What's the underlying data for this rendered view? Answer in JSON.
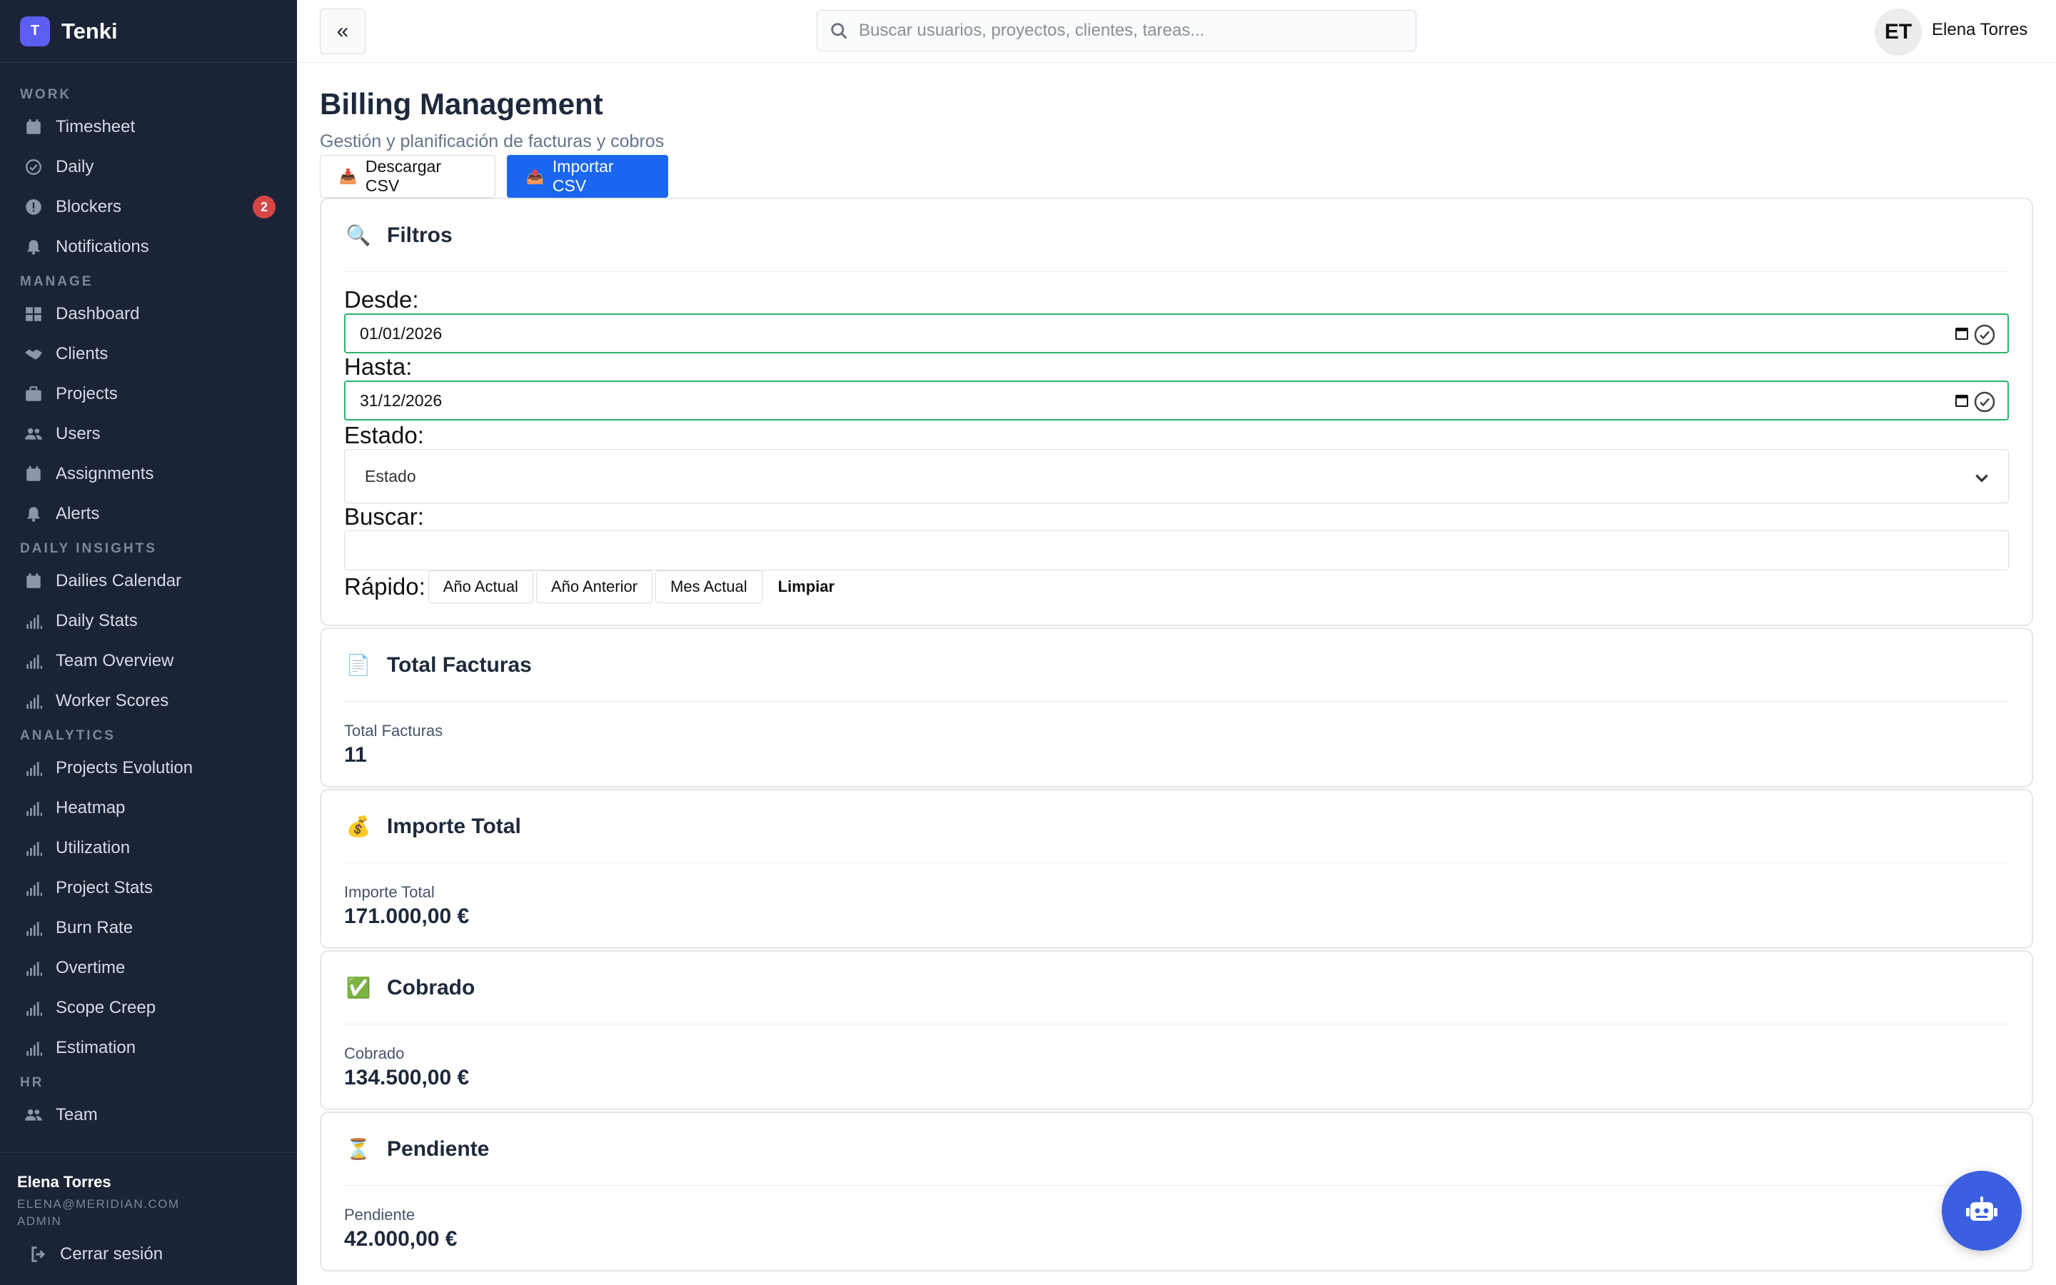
{
  "brand": {
    "logo_letter": "T",
    "name": "Tenki"
  },
  "sidebar": {
    "sections": [
      {
        "title": "WORK",
        "items": [
          {
            "label": "Timesheet",
            "icon": "calendar-icon"
          },
          {
            "label": "Daily",
            "icon": "check-circle-icon"
          },
          {
            "label": "Blockers",
            "icon": "alert-circle-icon",
            "badge": "2"
          },
          {
            "label": "Notifications",
            "icon": "bell-icon"
          }
        ]
      },
      {
        "title": "MANAGE",
        "items": [
          {
            "label": "Dashboard",
            "icon": "grid-icon"
          },
          {
            "label": "Clients",
            "icon": "handshake-icon"
          },
          {
            "label": "Projects",
            "icon": "briefcase-icon"
          },
          {
            "label": "Users",
            "icon": "users-icon"
          },
          {
            "label": "Assignments",
            "icon": "calendar-icon"
          },
          {
            "label": "Alerts",
            "icon": "bell-icon"
          }
        ]
      },
      {
        "title": "DAILY INSIGHTS",
        "items": [
          {
            "label": "Dailies Calendar",
            "icon": "calendar-icon"
          },
          {
            "label": "Daily Stats",
            "icon": "bar-chart-icon"
          },
          {
            "label": "Team Overview",
            "icon": "bar-chart-icon"
          },
          {
            "label": "Worker Scores",
            "icon": "bar-chart-icon"
          }
        ]
      },
      {
        "title": "ANALYTICS",
        "items": [
          {
            "label": "Projects Evolution",
            "icon": "bar-chart-icon"
          },
          {
            "label": "Heatmap",
            "icon": "bar-chart-icon"
          },
          {
            "label": "Utilization",
            "icon": "bar-chart-icon"
          },
          {
            "label": "Project Stats",
            "icon": "bar-chart-icon"
          },
          {
            "label": "Burn Rate",
            "icon": "bar-chart-icon"
          },
          {
            "label": "Overtime",
            "icon": "bar-chart-icon"
          },
          {
            "label": "Scope Creep",
            "icon": "bar-chart-icon"
          },
          {
            "label": "Estimation",
            "icon": "bar-chart-icon"
          }
        ]
      },
      {
        "title": "HR",
        "items": [
          {
            "label": "Team",
            "icon": "users-icon"
          }
        ]
      }
    ],
    "footer": {
      "name": "Elena Torres",
      "email": "ELENA@MERIDIAN.COM",
      "role": "ADMIN",
      "logout_label": "Cerrar sesión"
    }
  },
  "topbar": {
    "collapse_label": "«",
    "search_placeholder": "Buscar usuarios, proyectos, clientes, tareas...",
    "avatar_initials": "ET",
    "user_name": "Elena Torres"
  },
  "page": {
    "title": "Billing Management",
    "subtitle": "Gestión y planificación de facturas y cobros",
    "download_label": "Descargar CSV",
    "import_label": "Importar CSV"
  },
  "filters": {
    "title": "Filtros",
    "from_label": "Desde:",
    "from_value": "01/01/2026",
    "to_label": "Hasta:",
    "to_value": "31/12/2026",
    "status_label": "Estado:",
    "status_value": "Estado",
    "search_label": "Buscar:",
    "search_value": "",
    "quick_label": "Rápido:",
    "quick_options": [
      "Año Actual",
      "Año Anterior",
      "Mes Actual"
    ],
    "clear_label": "Limpiar"
  },
  "stats": [
    {
      "emoji": "📄",
      "title": "Total Facturas",
      "label": "Total Facturas",
      "value": "11"
    },
    {
      "emoji": "💰",
      "title": "Importe Total",
      "label": "Importe Total",
      "value": "171.000,00 €"
    },
    {
      "emoji": "✅",
      "title": "Cobrado",
      "label": "Cobrado",
      "value": "134.500,00 €"
    },
    {
      "emoji": "⏳",
      "title": "Pendiente",
      "label": "Pendiente",
      "value": "42.000,00 €"
    }
  ],
  "colors": {
    "sidebar_bg": "#1b2336",
    "brand_accent": "#5b5ef0",
    "primary": "#1a66f0",
    "valid_green": "#2bb56a",
    "badge_red": "#d64545",
    "fab_bg": "#3b5fe0"
  }
}
